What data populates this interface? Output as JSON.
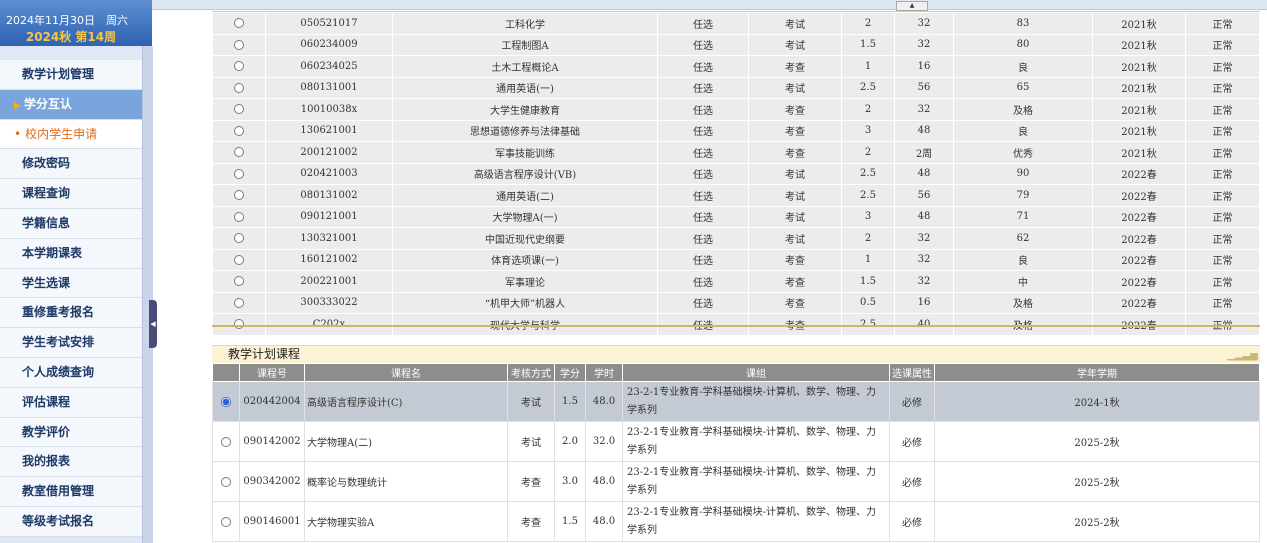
{
  "sidebar": {
    "date": "2024年11月30日　周六",
    "term": "2024秋 第14周",
    "menu": [
      {
        "label": "教学计划管理"
      },
      {
        "label": "学分互认"
      },
      {
        "label": "校内学生申请"
      },
      {
        "label": "修改密码"
      },
      {
        "label": "课程查询"
      },
      {
        "label": "学籍信息"
      },
      {
        "label": "本学期课表"
      },
      {
        "label": "学生选课"
      },
      {
        "label": "重修重考报名"
      },
      {
        "label": "学生考试安排"
      },
      {
        "label": "个人成绩查询"
      },
      {
        "label": "评估课程"
      },
      {
        "label": "教学评价"
      },
      {
        "label": "我的报表"
      },
      {
        "label": "教室借用管理"
      },
      {
        "label": "等级考试报名"
      }
    ]
  },
  "grades_table": {
    "rows": [
      {
        "code": "050521017",
        "name": "工科化学",
        "type": "任选",
        "exam": "考试",
        "credit": "2",
        "hours": "32",
        "score": "83",
        "term": "2021秋",
        "status": "正常"
      },
      {
        "code": "060234009",
        "name": "工程制图A",
        "type": "任选",
        "exam": "考试",
        "credit": "1.5",
        "hours": "32",
        "score": "80",
        "term": "2021秋",
        "status": "正常"
      },
      {
        "code": "060234025",
        "name": "土木工程概论A",
        "type": "任选",
        "exam": "考查",
        "credit": "1",
        "hours": "16",
        "score": "良",
        "term": "2021秋",
        "status": "正常"
      },
      {
        "code": "080131001",
        "name": "通用英语(一)",
        "type": "任选",
        "exam": "考试",
        "credit": "2.5",
        "hours": "56",
        "score": "65",
        "term": "2021秋",
        "status": "正常"
      },
      {
        "code": "10010038x",
        "name": "大学生健康教育",
        "type": "任选",
        "exam": "考查",
        "credit": "2",
        "hours": "32",
        "score": "及格",
        "term": "2021秋",
        "status": "正常"
      },
      {
        "code": "130621001",
        "name": "思想道德修养与法律基础",
        "type": "任选",
        "exam": "考查",
        "credit": "3",
        "hours": "48",
        "score": "良",
        "term": "2021秋",
        "status": "正常"
      },
      {
        "code": "200121002",
        "name": "军事技能训练",
        "type": "任选",
        "exam": "考查",
        "credit": "2",
        "hours": "2周",
        "score": "优秀",
        "term": "2021秋",
        "status": "正常"
      },
      {
        "code": "020421003",
        "name": "高级语言程序设计(VB)",
        "type": "任选",
        "exam": "考试",
        "credit": "2.5",
        "hours": "48",
        "score": "90",
        "term": "2022春",
        "status": "正常"
      },
      {
        "code": "080131002",
        "name": "通用英语(二)",
        "type": "任选",
        "exam": "考试",
        "credit": "2.5",
        "hours": "56",
        "score": "79",
        "term": "2022春",
        "status": "正常"
      },
      {
        "code": "090121001",
        "name": "大学物理A(一)",
        "type": "任选",
        "exam": "考试",
        "credit": "3",
        "hours": "48",
        "score": "71",
        "term": "2022春",
        "status": "正常"
      },
      {
        "code": "130321001",
        "name": "中国近现代史纲要",
        "type": "任选",
        "exam": "考试",
        "credit": "2",
        "hours": "32",
        "score": "62",
        "term": "2022春",
        "status": "正常"
      },
      {
        "code": "160121002",
        "name": "体育选项课(一)",
        "type": "任选",
        "exam": "考查",
        "credit": "1",
        "hours": "32",
        "score": "良",
        "term": "2022春",
        "status": "正常"
      },
      {
        "code": "200221001",
        "name": "军事理论",
        "type": "任选",
        "exam": "考查",
        "credit": "1.5",
        "hours": "32",
        "score": "中",
        "term": "2022春",
        "status": "正常"
      },
      {
        "code": "300333022",
        "name": "“机甲大师”机器人",
        "type": "任选",
        "exam": "考查",
        "credit": "0.5",
        "hours": "16",
        "score": "及格",
        "term": "2022春",
        "status": "正常"
      },
      {
        "code": "C202x",
        "name": "现代大学与科学",
        "type": "任选",
        "exam": "考查",
        "credit": "2.5",
        "hours": "40",
        "score": "及格",
        "term": "2022春",
        "status": "正常"
      }
    ]
  },
  "plan": {
    "title": "教学计划课程",
    "headers": {
      "code": "课程号",
      "name": "课程名",
      "exam": "考核方式",
      "credit": "学分",
      "hours": "学时",
      "group": "课组",
      "attr": "选课属性",
      "term": "学年学期"
    },
    "rows": [
      {
        "selected": true,
        "code": "020442004",
        "name": "高级语言程序设计(C)",
        "exam": "考试",
        "credit": "1.5",
        "hours": "48.0",
        "group": "23-2-1专业教育-学科基础模块-计算机、数学、物理、力学系列",
        "attr": "必修",
        "term": "2024-1秋"
      },
      {
        "selected": false,
        "code": "090142002",
        "name": "大学物理A(二)",
        "exam": "考试",
        "credit": "2.0",
        "hours": "32.0",
        "group": "23-2-1专业教育-学科基础模块-计算机、数学、物理、力学系列",
        "attr": "必修",
        "term": "2025-2秋"
      },
      {
        "selected": false,
        "code": "090342002",
        "name": "概率论与数理统计",
        "exam": "考查",
        "credit": "3.0",
        "hours": "48.0",
        "group": "23-2-1专业教育-学科基础模块-计算机、数学、物理、力学系列",
        "attr": "必修",
        "term": "2025-2秋"
      },
      {
        "selected": false,
        "code": "090146001",
        "name": "大学物理实验A",
        "exam": "考查",
        "credit": "1.5",
        "hours": "48.0",
        "group": "23-2-1专业教育-学科基础模块-计算机、数学、物理、力学系列",
        "attr": "必修",
        "term": "2025-2秋"
      }
    ]
  },
  "colors": {
    "sidebar_header": "#2d62b4",
    "term_text": "#f4c542",
    "active_item": "#7aa4dc",
    "sub_item_text": "#e06a1c",
    "table_header": "#8d8d8d"
  }
}
